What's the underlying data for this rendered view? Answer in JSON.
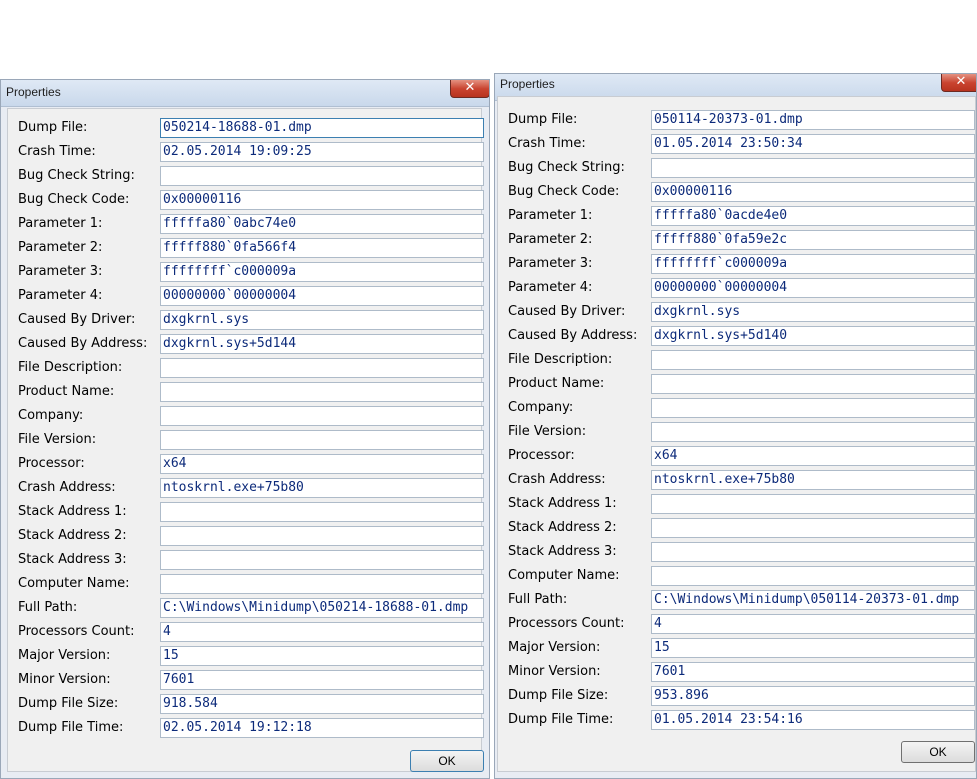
{
  "left_dialog": {
    "title": "Properties",
    "close_glyph": "✕",
    "ok_label": "OK",
    "fields": [
      {
        "label": "Dump File:",
        "value": "050214-18688-01.dmp"
      },
      {
        "label": "Crash Time:",
        "value": "02.05.2014 19:09:25"
      },
      {
        "label": "Bug Check String:",
        "value": ""
      },
      {
        "label": "Bug Check Code:",
        "value": "0x00000116"
      },
      {
        "label": "Parameter 1:",
        "value": "fffffa80`0abc74e0"
      },
      {
        "label": "Parameter 2:",
        "value": "fffff880`0fa566f4"
      },
      {
        "label": "Parameter 3:",
        "value": "ffffffff`c000009a"
      },
      {
        "label": "Parameter 4:",
        "value": "00000000`00000004"
      },
      {
        "label": "Caused By Driver:",
        "value": "dxgkrnl.sys"
      },
      {
        "label": "Caused By Address:",
        "value": "dxgkrnl.sys+5d144"
      },
      {
        "label": "File Description:",
        "value": ""
      },
      {
        "label": "Product Name:",
        "value": ""
      },
      {
        "label": "Company:",
        "value": ""
      },
      {
        "label": "File Version:",
        "value": ""
      },
      {
        "label": "Processor:",
        "value": "x64"
      },
      {
        "label": "Crash Address:",
        "value": "ntoskrnl.exe+75b80"
      },
      {
        "label": "Stack Address 1:",
        "value": ""
      },
      {
        "label": "Stack Address 2:",
        "value": ""
      },
      {
        "label": "Stack Address 3:",
        "value": ""
      },
      {
        "label": "Computer Name:",
        "value": ""
      },
      {
        "label": "Full Path:",
        "value": "C:\\Windows\\Minidump\\050214-18688-01.dmp"
      },
      {
        "label": "Processors Count:",
        "value": "4"
      },
      {
        "label": "Major Version:",
        "value": "15"
      },
      {
        "label": "Minor Version:",
        "value": "7601"
      },
      {
        "label": "Dump File Size:",
        "value": "918.584"
      },
      {
        "label": "Dump File Time:",
        "value": "02.05.2014 19:12:18"
      }
    ]
  },
  "right_dialog": {
    "title": "Properties",
    "close_glyph": "✕",
    "ok_label": "OK",
    "fields": [
      {
        "label": "Dump File:",
        "value": "050114-20373-01.dmp"
      },
      {
        "label": "Crash Time:",
        "value": "01.05.2014 23:50:34"
      },
      {
        "label": "Bug Check String:",
        "value": ""
      },
      {
        "label": "Bug Check Code:",
        "value": "0x00000116"
      },
      {
        "label": "Parameter 1:",
        "value": "fffffa80`0acde4e0"
      },
      {
        "label": "Parameter 2:",
        "value": "fffff880`0fa59e2c"
      },
      {
        "label": "Parameter 3:",
        "value": "ffffffff`c000009a"
      },
      {
        "label": "Parameter 4:",
        "value": "00000000`00000004"
      },
      {
        "label": "Caused By Driver:",
        "value": "dxgkrnl.sys"
      },
      {
        "label": "Caused By Address:",
        "value": "dxgkrnl.sys+5d140"
      },
      {
        "label": "File Description:",
        "value": ""
      },
      {
        "label": "Product Name:",
        "value": ""
      },
      {
        "label": "Company:",
        "value": ""
      },
      {
        "label": "File Version:",
        "value": ""
      },
      {
        "label": "Processor:",
        "value": "x64"
      },
      {
        "label": "Crash Address:",
        "value": "ntoskrnl.exe+75b80"
      },
      {
        "label": "Stack Address 1:",
        "value": ""
      },
      {
        "label": "Stack Address 2:",
        "value": ""
      },
      {
        "label": "Stack Address 3:",
        "value": ""
      },
      {
        "label": "Computer Name:",
        "value": ""
      },
      {
        "label": "Full Path:",
        "value": "C:\\Windows\\Minidump\\050114-20373-01.dmp"
      },
      {
        "label": "Processors Count:",
        "value": "4"
      },
      {
        "label": "Major Version:",
        "value": "15"
      },
      {
        "label": "Minor Version:",
        "value": "7601"
      },
      {
        "label": "Dump File Size:",
        "value": "953.896"
      },
      {
        "label": "Dump File Time:",
        "value": "01.05.2014 23:54:16"
      }
    ]
  }
}
